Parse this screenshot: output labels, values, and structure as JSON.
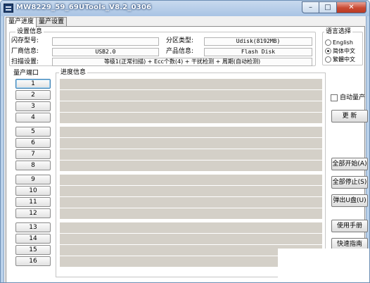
{
  "window": {
    "title": "MW8229_59_69UTools_V8.2_0306",
    "minimize": "–",
    "maximize": "□",
    "close": "✕"
  },
  "tabs": [
    "量产进度",
    "量产设置"
  ],
  "settings": {
    "group_label": "设置信息",
    "flash_model_label": "闪存型号:",
    "flash_model_value": "",
    "partition_label": "分区类型:",
    "partition_value": "Udisk(8192MB)",
    "vendor_label": "厂商信息:",
    "vendor_value": "USB2.0",
    "product_label": "产品信息:",
    "product_value": "Flash Disk",
    "scan_label": "扫描设置:",
    "scan_value": "等级1(正常扫描) + Ecc个数(4) + 干扰检测 + 周期(自动检测)"
  },
  "language": {
    "label": "语言选择",
    "options": [
      {
        "label": "English",
        "selected": false
      },
      {
        "label": "简体中文",
        "selected": true
      },
      {
        "label": "繁體中文",
        "selected": false
      }
    ]
  },
  "ports": {
    "label": "量产端口",
    "items": [
      "1",
      "2",
      "3",
      "4",
      "5",
      "6",
      "7",
      "8",
      "9",
      "10",
      "11",
      "12",
      "13",
      "14",
      "15",
      "16"
    ]
  },
  "progress": {
    "label": "进度信息"
  },
  "controls": {
    "auto_label": "自动量产",
    "refresh": "更  新",
    "start_all": "全部开始(A)",
    "stop_all": "全部停止(S)",
    "eject": "弹出U盘(U)",
    "manual": "使用手册",
    "quick_guide": "快速指南"
  }
}
